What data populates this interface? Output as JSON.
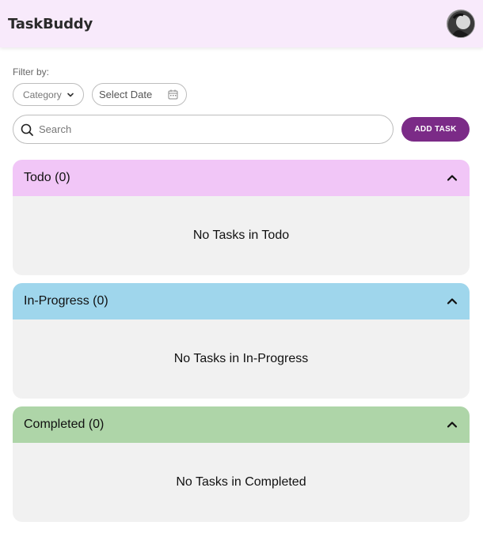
{
  "header": {
    "title": "TaskBuddy",
    "avatar_icon": "user-avatar"
  },
  "filters": {
    "label": "Filter by:",
    "category_placeholder": "Category",
    "date_placeholder": "Select Date"
  },
  "search": {
    "placeholder": "Search"
  },
  "actions": {
    "add_task_label": "ADD TASK",
    "accent_color": "#7b2b87"
  },
  "sections": [
    {
      "title": "Todo (0)",
      "empty_text": "No Tasks in Todo",
      "color": "#f1c6f7",
      "expanded": true
    },
    {
      "title": "In-Progress (0)",
      "empty_text": "No Tasks in In-Progress",
      "color": "#9fd6ec",
      "expanded": true
    },
    {
      "title": "Completed (0)",
      "empty_text": "No Tasks in Completed",
      "color": "#aed5a8",
      "expanded": true
    }
  ]
}
